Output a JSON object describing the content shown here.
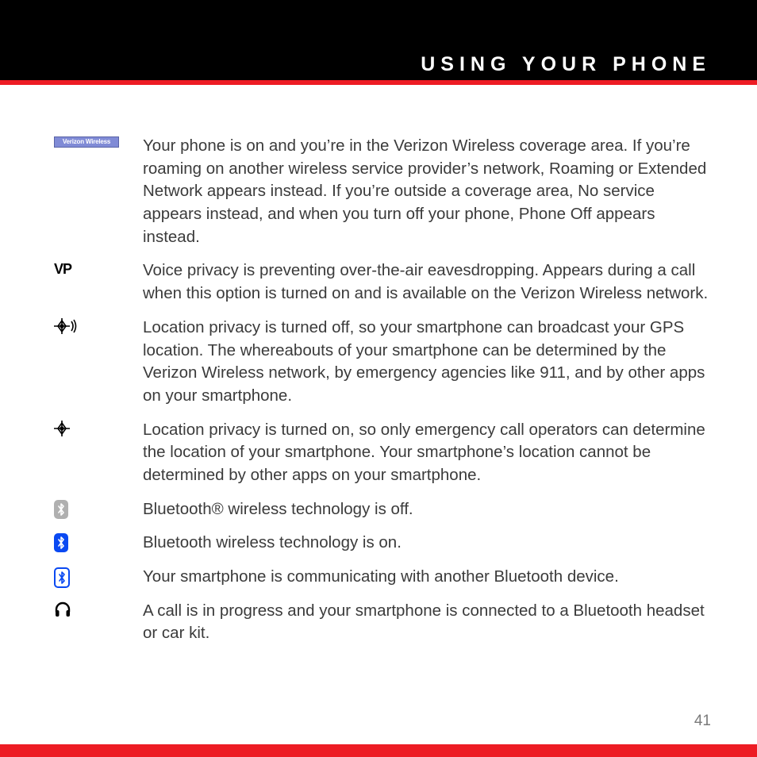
{
  "header": {
    "title": "USING YOUR PHONE"
  },
  "icons": {
    "carrier_label": "Verizon Wireless"
  },
  "rows": [
    {
      "icon": "carrier",
      "text": "Your phone is on and you’re in the Verizon Wireless coverage area. If you’re roaming on another wireless service provider’s network, Roaming or Extended Network appears instead. If you’re outside a coverage area, No service appears instead, and when you turn off your phone, Phone Off appears instead."
    },
    {
      "icon": "vp",
      "text": "Voice privacy is preventing over-the-air eavesdropping. Appears during a call when this option is turned on and is available on the Verizon Wireless network."
    },
    {
      "icon": "location-on",
      "text": "Location privacy is turned off, so your smartphone can broadcast your GPS location. The whereabouts of your smartphone can be determined by the Verizon Wireless network, by emergency agencies like 911, and by other apps on your smartphone."
    },
    {
      "icon": "location-off",
      "text": "Location privacy is turned on, so only emergency call operators can determine the location of your smartphone. Your smartphone’s location cannot be determined by other apps on your smartphone."
    },
    {
      "icon": "bt-off",
      "text": " Bluetooth® wireless technology is off."
    },
    {
      "icon": "bt-on",
      "text": "Bluetooth wireless technology is on."
    },
    {
      "icon": "bt-comm",
      "text": "Your smartphone is communicating with another Bluetooth device."
    },
    {
      "icon": "headset",
      "text": "A call is in progress and your smartphone is connected to a Bluetooth headset or car kit."
    }
  ],
  "page_number": "41"
}
